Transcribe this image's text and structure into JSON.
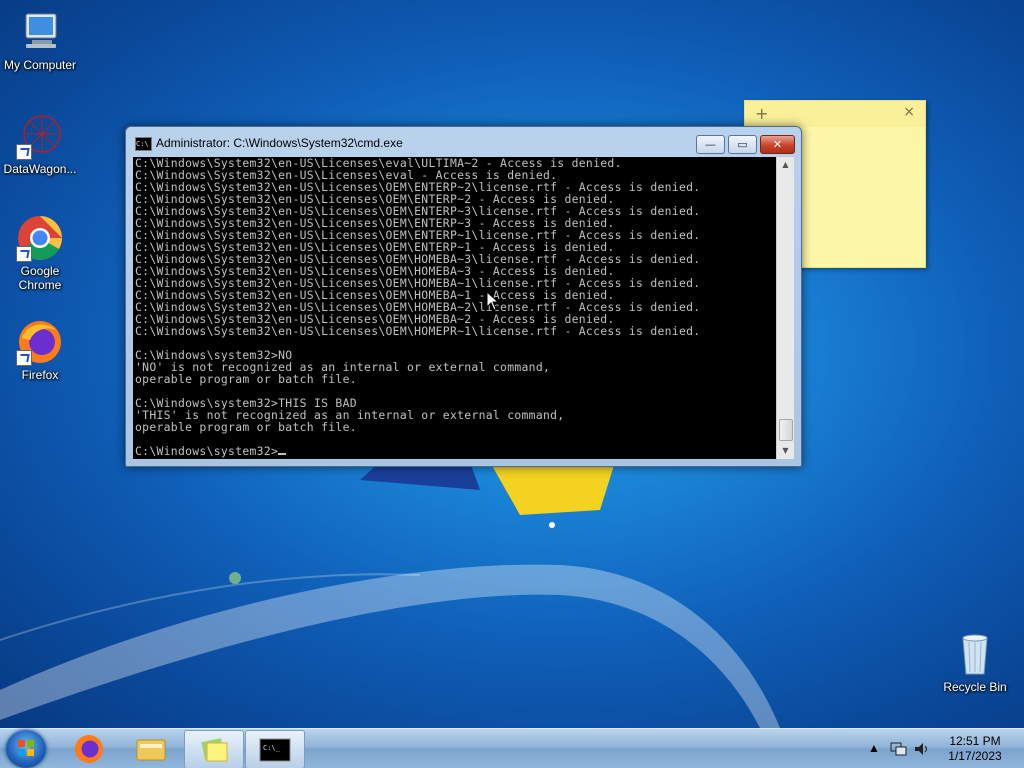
{
  "desktop": {
    "icons": [
      {
        "label": "My Computer"
      },
      {
        "label": "DataWagon..."
      },
      {
        "label": "Google Chrome"
      },
      {
        "label": "Firefox"
      },
      {
        "label": "Recycle Bin"
      }
    ]
  },
  "sticky_note": {
    "add_label": "+",
    "close_label": "×"
  },
  "cmd_window": {
    "title": "Administrator: C:\\Windows\\System32\\cmd.exe",
    "minimize_label": "—",
    "maximize_label": "▭",
    "close_label": "✕",
    "console_lines": [
      "C:\\Windows\\System32\\en-US\\Licenses\\eval\\ULTIMA~2 - Access is denied.",
      "C:\\Windows\\System32\\en-US\\Licenses\\eval - Access is denied.",
      "C:\\Windows\\System32\\en-US\\Licenses\\OEM\\ENTERP~2\\license.rtf - Access is denied.",
      "C:\\Windows\\System32\\en-US\\Licenses\\OEM\\ENTERP~2 - Access is denied.",
      "C:\\Windows\\System32\\en-US\\Licenses\\OEM\\ENTERP~3\\license.rtf - Access is denied.",
      "C:\\Windows\\System32\\en-US\\Licenses\\OEM\\ENTERP~3 - Access is denied.",
      "C:\\Windows\\System32\\en-US\\Licenses\\OEM\\ENTERP~1\\license.rtf - Access is denied.",
      "C:\\Windows\\System32\\en-US\\Licenses\\OEM\\ENTERP~1 - Access is denied.",
      "C:\\Windows\\System32\\en-US\\Licenses\\OEM\\HOMEBA~3\\license.rtf - Access is denied.",
      "C:\\Windows\\System32\\en-US\\Licenses\\OEM\\HOMEBA~3 - Access is denied.",
      "C:\\Windows\\System32\\en-US\\Licenses\\OEM\\HOMEBA~1\\license.rtf - Access is denied.",
      "C:\\Windows\\System32\\en-US\\Licenses\\OEM\\HOMEBA~1 - Access is denied.",
      "C:\\Windows\\System32\\en-US\\Licenses\\OEM\\HOMEBA~2\\license.rtf - Access is denied.",
      "C:\\Windows\\System32\\en-US\\Licenses\\OEM\\HOMEBA~2 - Access is denied.",
      "C:\\Windows\\System32\\en-US\\Licenses\\OEM\\HOMEPR~1\\license.rtf - Access is denied.",
      "",
      "C:\\Windows\\system32>NO",
      "'NO' is not recognized as an internal or external command,",
      "operable program or batch file.",
      "",
      "C:\\Windows\\system32>THIS IS BAD",
      "'THIS' is not recognized as an internal or external command,",
      "operable program or batch file.",
      ""
    ],
    "prompt": "C:\\Windows\\system32>"
  },
  "taskbar": {
    "clock_time": "12:51 PM",
    "clock_date": "1/17/2023",
    "tray_arrow": "▲"
  },
  "colors": {
    "console_bg": "#000000",
    "console_fg": "#c0c0c0",
    "sticky_bg": "#fdf7a8"
  }
}
